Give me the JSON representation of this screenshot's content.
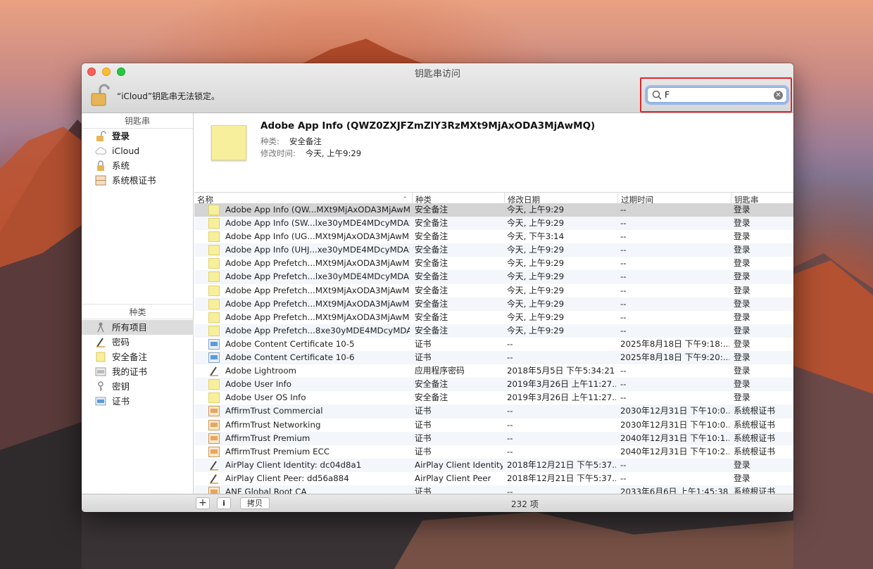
{
  "window": {
    "title": "钥匙串访问",
    "lock_message": "“iCloud”钥匙串无法锁定。"
  },
  "search": {
    "value": "F"
  },
  "sidebar": {
    "keychains_header": "钥匙串",
    "keychains": [
      {
        "label": "登录",
        "icon": "lock-open-icon"
      },
      {
        "label": "iCloud",
        "icon": "cloud-icon"
      },
      {
        "label": "系统",
        "icon": "lock-icon"
      },
      {
        "label": "系统根证书",
        "icon": "cabinet-icon"
      }
    ],
    "category_header": "种类",
    "categories": [
      {
        "label": "所有项目",
        "icon": "all-items-icon"
      },
      {
        "label": "密码",
        "icon": "pencil-icon"
      },
      {
        "label": "安全备注",
        "icon": "note-icon"
      },
      {
        "label": "我的证书",
        "icon": "my-cert-icon"
      },
      {
        "label": "密钥",
        "icon": "key-icon"
      },
      {
        "label": "证书",
        "icon": "cert-icon"
      }
    ]
  },
  "detail": {
    "name": "Adobe App Info (QWZ0ZXJFZmZlY3RzMXt9MjAxODA3MjAwMQ)",
    "kind_label": "种类:",
    "kind_value": "安全备注",
    "modified_label": "修改时间:",
    "modified_value": "今天, 上午9:29"
  },
  "table": {
    "columns": [
      "名称",
      "种类",
      "修改日期",
      "过期时间",
      "钥匙串"
    ],
    "rows": [
      {
        "icon": "note",
        "name": "Adobe App Info (QW...MXt9MjAxODA3MjAwMQ)",
        "kind": "安全备注",
        "modified": "今天, 上午9:29",
        "expires": "--",
        "keychain": "登录"
      },
      {
        "icon": "note",
        "name": "Adobe App Info (SW...lxe30yMDE4MDcyMDAx)",
        "kind": "安全备注",
        "modified": "今天, 上午9:29",
        "expires": "--",
        "keychain": "登录"
      },
      {
        "icon": "note",
        "name": "Adobe App Info (UG...MXt9MjAxODA3MjAwMQ)",
        "kind": "安全备注",
        "modified": "今天, 下午3:14",
        "expires": "--",
        "keychain": "登录"
      },
      {
        "icon": "note",
        "name": "Adobe App Info (UHJ...xe30yMDE4MDcyMDAx)",
        "kind": "安全备注",
        "modified": "今天, 上午9:29",
        "expires": "--",
        "keychain": "登录"
      },
      {
        "icon": "note",
        "name": "Adobe App Prefetch...MXt9MjAxODA3MjAwMQ)",
        "kind": "安全备注",
        "modified": "今天, 上午9:29",
        "expires": "--",
        "keychain": "登录"
      },
      {
        "icon": "note",
        "name": "Adobe App Prefetch...lxe30yMDE4MDcyMDAx)",
        "kind": "安全备注",
        "modified": "今天, 上午9:29",
        "expires": "--",
        "keychain": "登录"
      },
      {
        "icon": "note",
        "name": "Adobe App Prefetch...MXt9MjAxODA3MjAwMQ)",
        "kind": "安全备注",
        "modified": "今天, 上午9:29",
        "expires": "--",
        "keychain": "登录"
      },
      {
        "icon": "note",
        "name": "Adobe App Prefetch...MXt9MjAxODA3MjAwMQ)",
        "kind": "安全备注",
        "modified": "今天, 上午9:29",
        "expires": "--",
        "keychain": "登录"
      },
      {
        "icon": "note",
        "name": "Adobe App Prefetch...MXt9MjAxODA3MjAwMQ)",
        "kind": "安全备注",
        "modified": "今天, 上午9:29",
        "expires": "--",
        "keychain": "登录"
      },
      {
        "icon": "note",
        "name": "Adobe App Prefetch...8xe30yMDE4MDcyMDAx)",
        "kind": "安全备注",
        "modified": "今天, 上午9:29",
        "expires": "--",
        "keychain": "登录"
      },
      {
        "icon": "cert",
        "name": "Adobe Content Certificate 10-5",
        "kind": "证书",
        "modified": "--",
        "expires": "2025年8月18日 下午9:18:...",
        "keychain": "登录"
      },
      {
        "icon": "cert",
        "name": "Adobe Content Certificate 10-6",
        "kind": "证书",
        "modified": "--",
        "expires": "2025年8月18日 下午9:20:...",
        "keychain": "登录"
      },
      {
        "icon": "password",
        "name": "Adobe Lightroom",
        "kind": "应用程序密码",
        "modified": "2018年5月5日 下午5:34:21",
        "expires": "--",
        "keychain": "登录"
      },
      {
        "icon": "note",
        "name": "Adobe User Info",
        "kind": "安全备注",
        "modified": "2019年3月26日 上午11:27...",
        "expires": "--",
        "keychain": "登录"
      },
      {
        "icon": "note",
        "name": "Adobe User OS Info",
        "kind": "安全备注",
        "modified": "2019年3月26日 上午11:27...",
        "expires": "--",
        "keychain": "登录"
      },
      {
        "icon": "root",
        "name": "AffirmTrust Commercial",
        "kind": "证书",
        "modified": "--",
        "expires": "2030年12月31日 下午10:0...",
        "keychain": "系统根证书"
      },
      {
        "icon": "root",
        "name": "AffirmTrust Networking",
        "kind": "证书",
        "modified": "--",
        "expires": "2030年12月31日 下午10:0...",
        "keychain": "系统根证书"
      },
      {
        "icon": "root",
        "name": "AffirmTrust Premium",
        "kind": "证书",
        "modified": "--",
        "expires": "2040年12月31日 下午10:1...",
        "keychain": "系统根证书"
      },
      {
        "icon": "root",
        "name": "AffirmTrust Premium ECC",
        "kind": "证书",
        "modified": "--",
        "expires": "2040年12月31日 下午10:2...",
        "keychain": "系统根证书"
      },
      {
        "icon": "password",
        "name": "AirPlay Client Identity: dc04d8a1",
        "kind": "AirPlay Client Identity",
        "modified": "2018年12月21日 下午5:37...",
        "expires": "--",
        "keychain": "登录"
      },
      {
        "icon": "password",
        "name": "AirPlay Client Peer: dd56a884",
        "kind": "AirPlay Client Peer",
        "modified": "2018年12月21日 下午5:37...",
        "expires": "--",
        "keychain": "登录"
      },
      {
        "icon": "root",
        "name": "ANF Global Root CA",
        "kind": "证书",
        "modified": "--",
        "expires": "2033年6月6日 上午1:45:38",
        "keychain": "系统根证书"
      }
    ]
  },
  "statusbar": {
    "add_label": "+",
    "info_label": "i",
    "copy_label": "拷贝",
    "count": "232 项"
  }
}
